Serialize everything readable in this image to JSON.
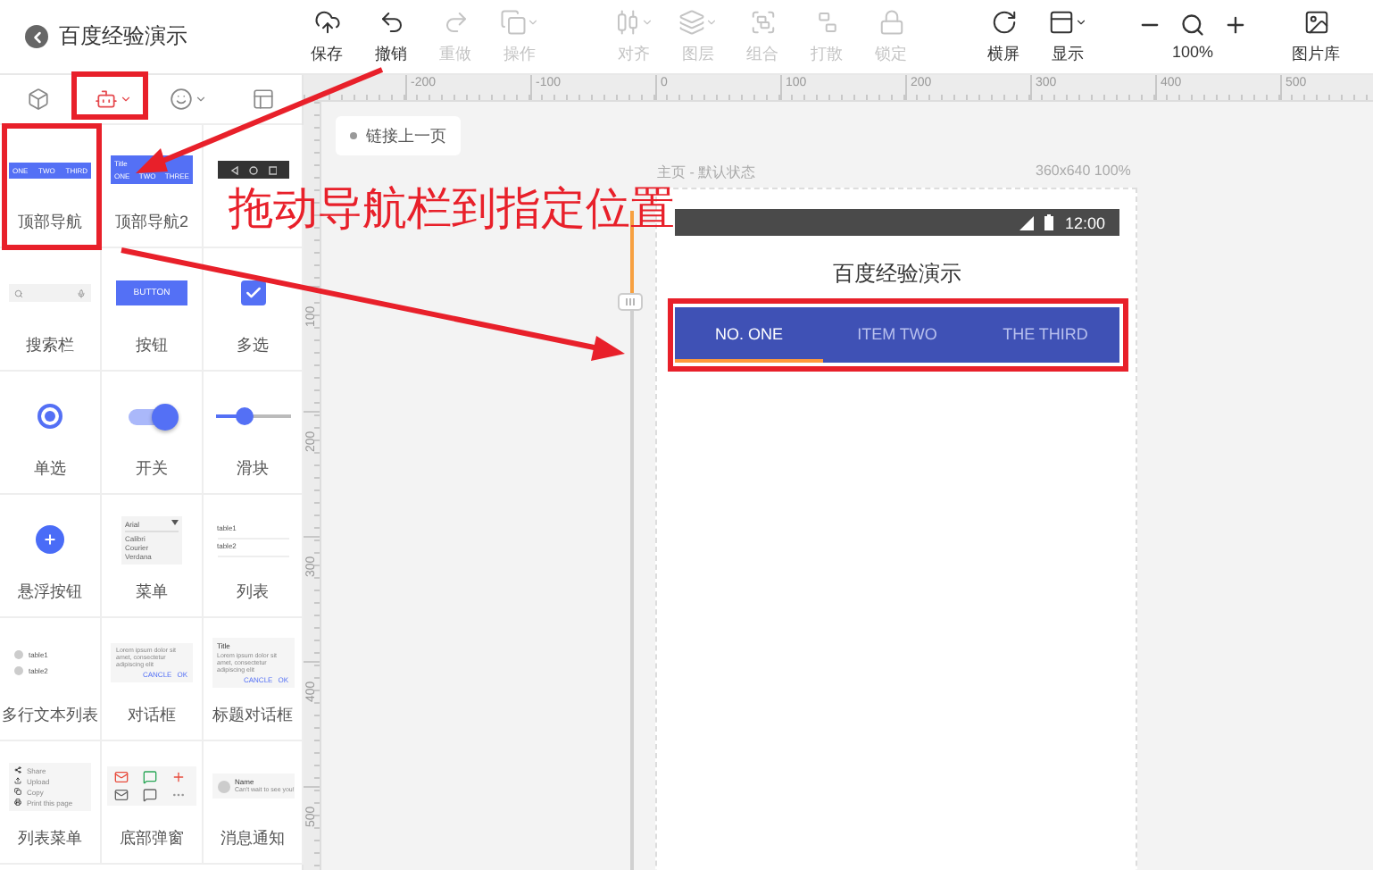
{
  "app_title": "百度经验演示",
  "edit_tools": [
    {
      "label": "保存",
      "disabled": false,
      "has_menu": false
    },
    {
      "label": "撤销",
      "disabled": false,
      "has_menu": false
    },
    {
      "label": "重做",
      "disabled": true,
      "has_menu": false
    },
    {
      "label": "操作",
      "disabled": true,
      "has_menu": true
    }
  ],
  "arrange_tools": [
    {
      "label": "对齐",
      "disabled": true,
      "has_menu": true
    },
    {
      "label": "图层",
      "disabled": true,
      "has_menu": true
    },
    {
      "label": "组合",
      "disabled": true,
      "has_menu": false
    },
    {
      "label": "打散",
      "disabled": true,
      "has_menu": false
    },
    {
      "label": "锁定",
      "disabled": true,
      "has_menu": false
    }
  ],
  "view_tools": [
    {
      "label": "横屏",
      "disabled": false,
      "has_menu": false
    },
    {
      "label": "显示",
      "disabled": false,
      "has_menu": true
    }
  ],
  "zoom": {
    "reading": "100%"
  },
  "image_library": {
    "label": "图片库"
  },
  "panel_tabs": [
    {
      "selected": false,
      "has_menu": false
    },
    {
      "selected": true,
      "has_menu": true
    },
    {
      "selected": false,
      "has_menu": true
    },
    {
      "selected": false,
      "has_menu": false
    }
  ],
  "components": [
    {
      "kind": "tabs",
      "label": "顶部导航",
      "texts": [
        "ONE",
        "TWO",
        "THIRD"
      ]
    },
    {
      "kind": "tabs2",
      "label": "顶部导航2",
      "title": "Title",
      "texts": [
        "ONE",
        "TWO",
        "THREE"
      ]
    },
    {
      "kind": "bottom_nav"
    },
    {
      "kind": "search",
      "label": "搜索栏"
    },
    {
      "kind": "button",
      "label": "按钮",
      "text": "BUTTON"
    },
    {
      "kind": "checkbox",
      "label": "多选",
      "checked": true
    },
    {
      "kind": "radio",
      "label": "单选",
      "checked": true
    },
    {
      "kind": "switch",
      "label": "开关",
      "on": true
    },
    {
      "kind": "slider",
      "label": "滑块",
      "level": 0.4
    },
    {
      "kind": "fab",
      "label": "悬浮按钮"
    },
    {
      "kind": "menu",
      "label": "菜单",
      "value": "Arial",
      "options": [
        "Calibri",
        "Courier",
        "Verdana"
      ]
    },
    {
      "kind": "list",
      "label": "列表",
      "texts": [
        "table1",
        "table2"
      ]
    },
    {
      "kind": "multi_list",
      "label": "多行文本列表",
      "texts": [
        "table1",
        "table2"
      ]
    },
    {
      "kind": "dialog",
      "label": "对话框",
      "body": "Lorem ipsum dolor sit amet, consectetur adipiscing elit",
      "actions": [
        "CANCLE",
        "OK"
      ]
    },
    {
      "kind": "dialog",
      "label": "标题对话框",
      "title": "Title",
      "body": "Lorem ipsum dolor sit amet, consectetur adipiscing elit",
      "actions": [
        "CANCLE",
        "OK"
      ]
    },
    {
      "kind": "list_menu",
      "label": "列表菜单",
      "texts": [
        "Share",
        "Upload",
        "Copy",
        "Print this page"
      ]
    },
    {
      "kind": "bottom_sheet",
      "label": "底部弹窗"
    },
    {
      "kind": "notification",
      "label": "消息通知",
      "title": "Name",
      "text": "Can't wait to see you!"
    }
  ],
  "canvas": {
    "x_ticks": [
      "-200",
      "-100",
      "0",
      "100",
      "200",
      "300",
      "400",
      "500"
    ],
    "y_ticks": [
      "100",
      "200",
      "300",
      "400",
      "500"
    ],
    "link_button": "链接上一页",
    "page_label": "主页 - 默认状态",
    "page_size": "360x640 100%",
    "phone": {
      "time": "12:00",
      "title": "百度经验演示",
      "tabs": [
        {
          "label": "NO. ONE",
          "selected": true
        },
        {
          "label": "ITEM TWO",
          "selected": false
        },
        {
          "label": "THE THIRD",
          "selected": false
        }
      ]
    }
  },
  "annotation": {
    "text": "拖动导航栏到指定位置"
  }
}
